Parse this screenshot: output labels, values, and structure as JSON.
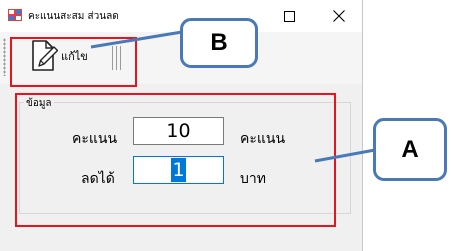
{
  "window": {
    "title": "คะแนนสะสม ส่วนลด",
    "maximize_symbol": "☐",
    "close_symbol": "✕"
  },
  "toolbar": {
    "edit_label": "แก้ไข",
    "edit_icon": "edit-document-icon"
  },
  "form": {
    "group_title": "ข้อมูล",
    "points_label": "คะแนน",
    "points_value": "10",
    "points_unit": "คะแนน",
    "discount_label": "ลดได้",
    "discount_value": "1",
    "discount_unit": "บาท"
  },
  "callouts": {
    "a_label": "A",
    "b_label": "B"
  },
  "colors": {
    "highlight_red": "#e8131c",
    "callout_blue": "#4a79b8",
    "selection_blue": "#0078d7"
  }
}
